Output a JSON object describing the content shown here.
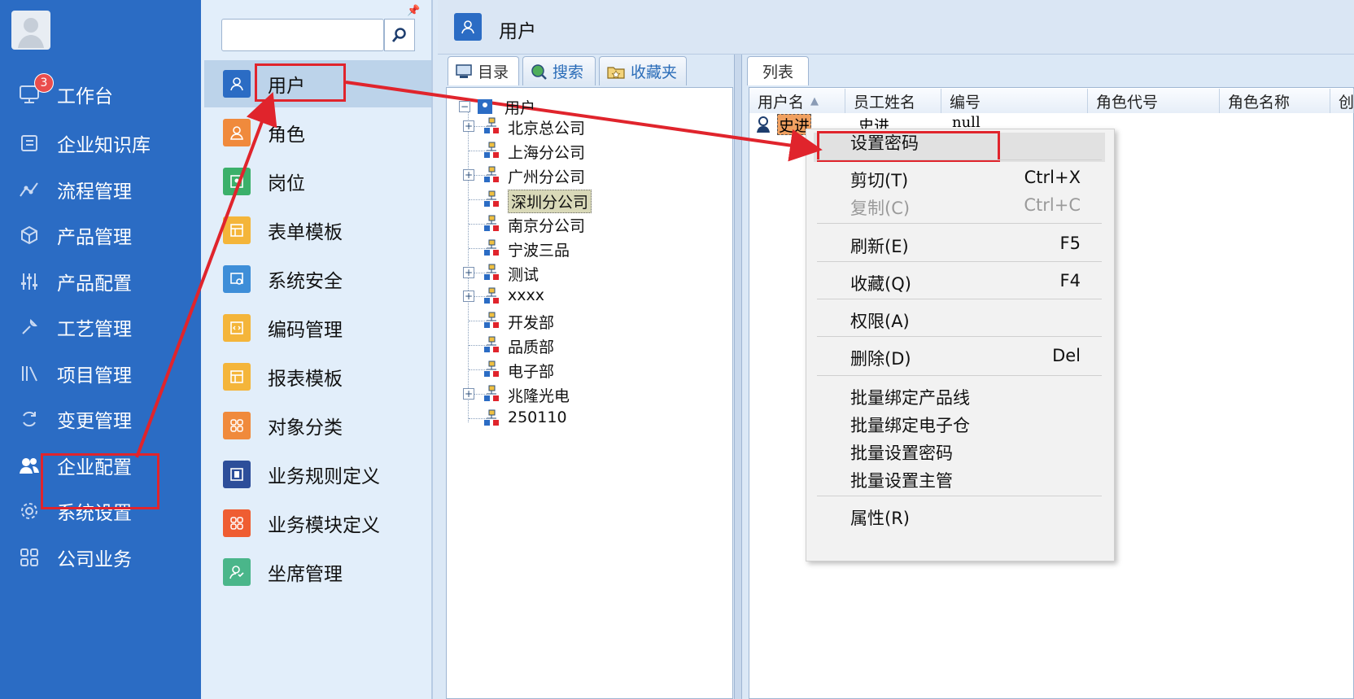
{
  "nav": {
    "badge": "3",
    "items": [
      "工作台",
      "企业知识库",
      "流程管理",
      "产品管理",
      "产品配置",
      "工艺管理",
      "项目管理",
      "变更管理",
      "企业配置",
      "系统设置",
      "公司业务"
    ]
  },
  "panel2": {
    "search_placeholder": "",
    "items": [
      "用户",
      "角色",
      "岗位",
      "表单模板",
      "系统安全",
      "编码管理",
      "报表模板",
      "对象分类",
      "业务规则定义",
      "业务模块定义",
      "坐席管理"
    ]
  },
  "header": {
    "title": "用户"
  },
  "left_tabs": [
    "目录",
    "搜索",
    "收藏夹"
  ],
  "tree": {
    "root": "用户",
    "nodes": [
      "北京总公司",
      "上海分公司",
      "广州分公司",
      "深圳分公司",
      "南京分公司",
      "宁波三品",
      "测试",
      "xxxx",
      "开发部",
      "品质部",
      "电子部",
      "兆隆光电",
      "250110"
    ]
  },
  "list": {
    "tab": "列表",
    "columns": [
      "用户名",
      "员工姓名",
      "编号",
      "角色代号",
      "角色名称",
      "创"
    ],
    "row": {
      "username": "史进",
      "name": "史进",
      "code": "null"
    }
  },
  "context_menu": {
    "items": [
      {
        "label": "设置密码",
        "shortcut": ""
      },
      {
        "label": "剪切(T)",
        "shortcut": "Ctrl+X"
      },
      {
        "label": "复制(C)",
        "shortcut": "Ctrl+C"
      },
      {
        "label": "刷新(E)",
        "shortcut": "F5"
      },
      {
        "label": "收藏(Q)",
        "shortcut": "F4"
      },
      {
        "label": "权限(A)",
        "shortcut": ""
      },
      {
        "label": "删除(D)",
        "shortcut": "Del"
      },
      {
        "label": "批量绑定产品线",
        "shortcut": ""
      },
      {
        "label": "批量绑定电子仓",
        "shortcut": ""
      },
      {
        "label": "批量设置密码",
        "shortcut": ""
      },
      {
        "label": "批量设置主管",
        "shortcut": ""
      },
      {
        "label": "属性(R)",
        "shortcut": ""
      }
    ]
  },
  "colors": {
    "nav_bg": "#2b6cc4",
    "annotation_red": "#e0242c",
    "panel2_bg": "#e2eefa"
  }
}
